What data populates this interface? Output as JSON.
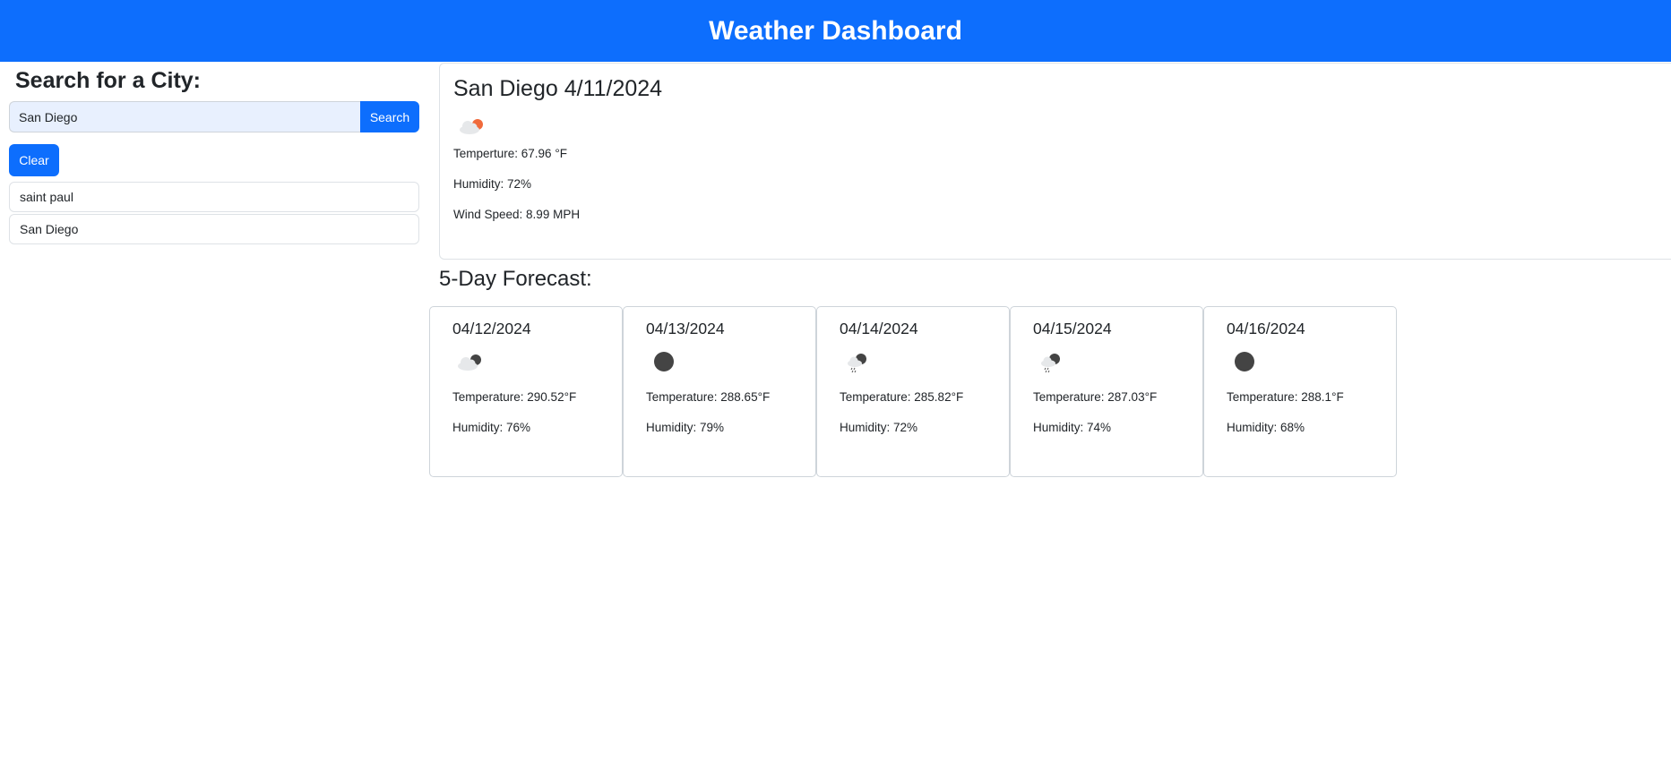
{
  "header": {
    "title": "Weather Dashboard"
  },
  "sidebar": {
    "heading": "Search for a City:",
    "search_value": "San Diego",
    "search_button": "Search",
    "clear_button": "Clear",
    "history": [
      "saint paul",
      "San Diego"
    ]
  },
  "current": {
    "title": "San Diego 4/11/2024",
    "icon": "cloud-sun-icon",
    "temperature": "Temperture: 67.96 °F",
    "humidity": "Humidity: 72%",
    "wind": "Wind Speed: 8.99 MPH"
  },
  "forecast": {
    "heading": "5-Day Forecast:",
    "days": [
      {
        "date": "04/12/2024",
        "icon": "cloud-moon-icon",
        "temp": "Temperature: 290.52°F",
        "humidity": "Humidity: 76%"
      },
      {
        "date": "04/13/2024",
        "icon": "moon-icon",
        "temp": "Temperature: 288.65°F",
        "humidity": "Humidity: 79%"
      },
      {
        "date": "04/14/2024",
        "icon": "cloud-moon-rain-icon",
        "temp": "Temperature: 285.82°F",
        "humidity": "Humidity: 72%"
      },
      {
        "date": "04/15/2024",
        "icon": "cloud-moon-rain-icon",
        "temp": "Temperature: 287.03°F",
        "humidity": "Humidity: 74%"
      },
      {
        "date": "04/16/2024",
        "icon": "moon-icon",
        "temp": "Temperature: 288.1°F",
        "humidity": "Humidity: 68%"
      }
    ]
  },
  "colors": {
    "primary": "#0d6efd",
    "sun": "#f06a3b",
    "moon": "#444444"
  }
}
